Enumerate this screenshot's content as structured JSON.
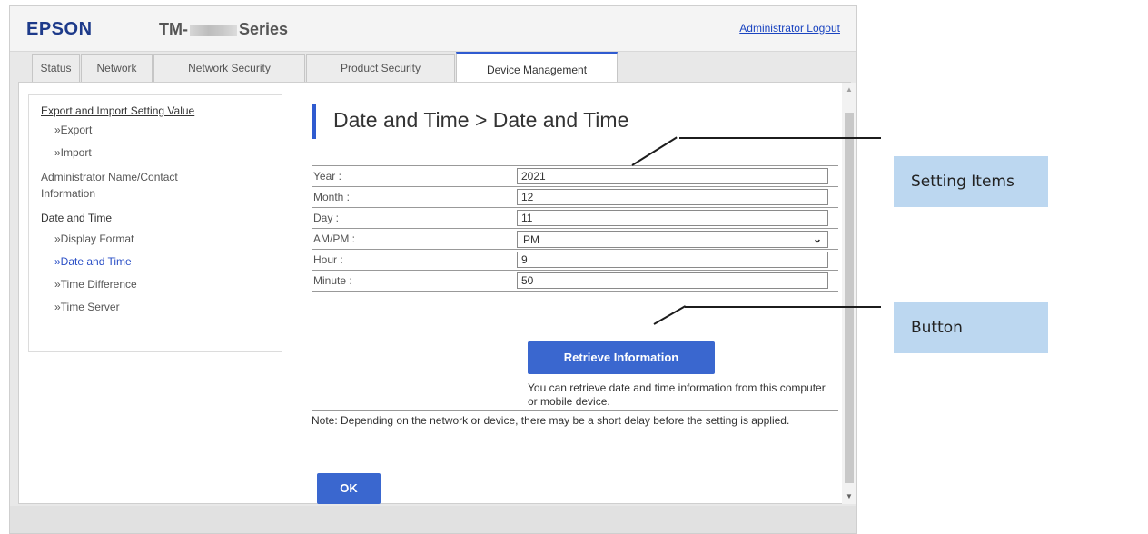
{
  "header": {
    "logo": "EPSON",
    "product_prefix": "TM-",
    "product_suffix": "Series",
    "logout_link": "Administrator Logout"
  },
  "tabs": [
    {
      "label": "Status"
    },
    {
      "label": "Network"
    },
    {
      "label": "Network Security"
    },
    {
      "label": "Product Security"
    },
    {
      "label": "Device Management"
    }
  ],
  "active_tab": "Device Management",
  "sidebar": {
    "export_import_heading": "Export and Import Setting Value",
    "export": "»Export",
    "import": "»Import",
    "admin_line1": "Administrator Name/Contact",
    "admin_line2": "Information",
    "datetime_heading": "Date and Time",
    "display_format": "»Display Format",
    "date_and_time": "»Date and Time",
    "time_difference": "»Time Difference",
    "time_server": "»Time Server"
  },
  "main": {
    "title": "Date and Time > Date and Time",
    "fields": {
      "year": {
        "label": "Year :",
        "value": "2021"
      },
      "month": {
        "label": "Month :",
        "value": "12"
      },
      "day": {
        "label": "Day :",
        "value": "11"
      },
      "ampm": {
        "label": "AM/PM :",
        "value": "PM"
      },
      "hour": {
        "label": "Hour :",
        "value": "9"
      },
      "minute": {
        "label": "Minute :",
        "value": "50"
      }
    },
    "retrieve_button": "Retrieve Information",
    "retrieve_note": "You can retrieve date and time information from this computer or mobile device.",
    "note": "Note: Depending on the network or device, there may be a short delay before the setting is applied.",
    "ok_button": "OK"
  },
  "callouts": {
    "setting_items": "Setting Items",
    "button": "Button"
  },
  "colors": {
    "brand_blue": "#1d3a8a",
    "button_blue": "#3a67cf",
    "callout_bg": "#bcd7f0",
    "link_blue": "#1a44c0"
  }
}
